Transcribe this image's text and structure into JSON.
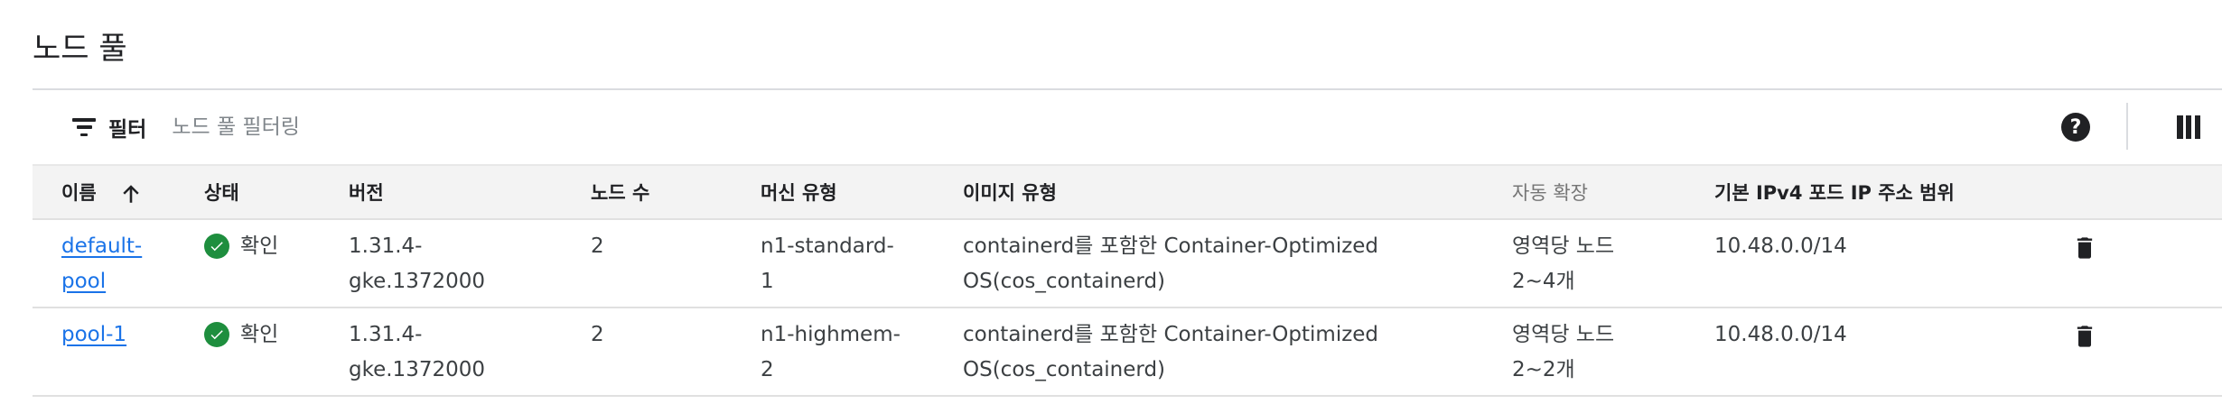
{
  "section": {
    "title": "노드 풀"
  },
  "toolbar": {
    "filter_label": "필터",
    "filter_placeholder": "노드 풀 필터링",
    "help_icon": "help-circle-icon",
    "columns_icon": "column-display-icon"
  },
  "table": {
    "columns": {
      "name": "이름",
      "status": "상태",
      "version": "버전",
      "node_count": "노드 수",
      "machine_type": "머신 유형",
      "image_type": "이미지 유형",
      "autoscaling": "자동 확장",
      "pod_ip_range": "기본 IPv4 포드 IP 주소 범위"
    },
    "sort": {
      "column": "name",
      "direction": "ascending",
      "icon": "arrow-up-icon"
    },
    "rows": [
      {
        "name_line1": "default-",
        "name_line2": "pool",
        "status": "확인",
        "version_line1": "1.31.4-",
        "version_line2": "gke.1372000",
        "node_count": "2",
        "machine_line1": "n1-standard-",
        "machine_line2": "1",
        "image_line1": "containerd를 포함한 Container-Optimized",
        "image_line2": "OS(cos_containerd)",
        "autoscale_line1": "영역당 노드",
        "autoscale_line2": "2~4개",
        "pod_ip_range": "10.48.0.0/14"
      },
      {
        "name_line1": "pool-1",
        "name_line2": "",
        "status": "확인",
        "version_line1": "1.31.4-",
        "version_line2": "gke.1372000",
        "node_count": "2",
        "machine_line1": "n1-highmem-",
        "machine_line2": "2",
        "image_line1": "containerd를 포함한 Container-Optimized",
        "image_line2": "OS(cos_containerd)",
        "autoscale_line1": "영역당 노드",
        "autoscale_line2": "2~2개",
        "pod_ip_range": "10.48.0.0/14"
      }
    ]
  },
  "colors": {
    "link": "#1a73e8",
    "status_ok": "#1e8e3e",
    "header_bg": "#f3f3f3",
    "border": "#e0e0e0"
  }
}
